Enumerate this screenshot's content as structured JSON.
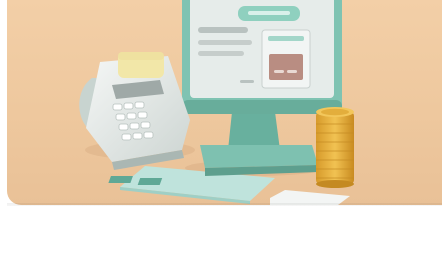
{
  "card": {
    "image_alt": "",
    "icons": [
      "payment-terminal-icon",
      "monitor-icon",
      "coin-stack-icon",
      "receipt-card-icon"
    ],
    "colors": {
      "background": "#f0cba2",
      "teal": "#7fc3b2",
      "teal_dark": "#5fa896",
      "screen": "#e8eeee",
      "gold": "#e5b23d"
    }
  }
}
